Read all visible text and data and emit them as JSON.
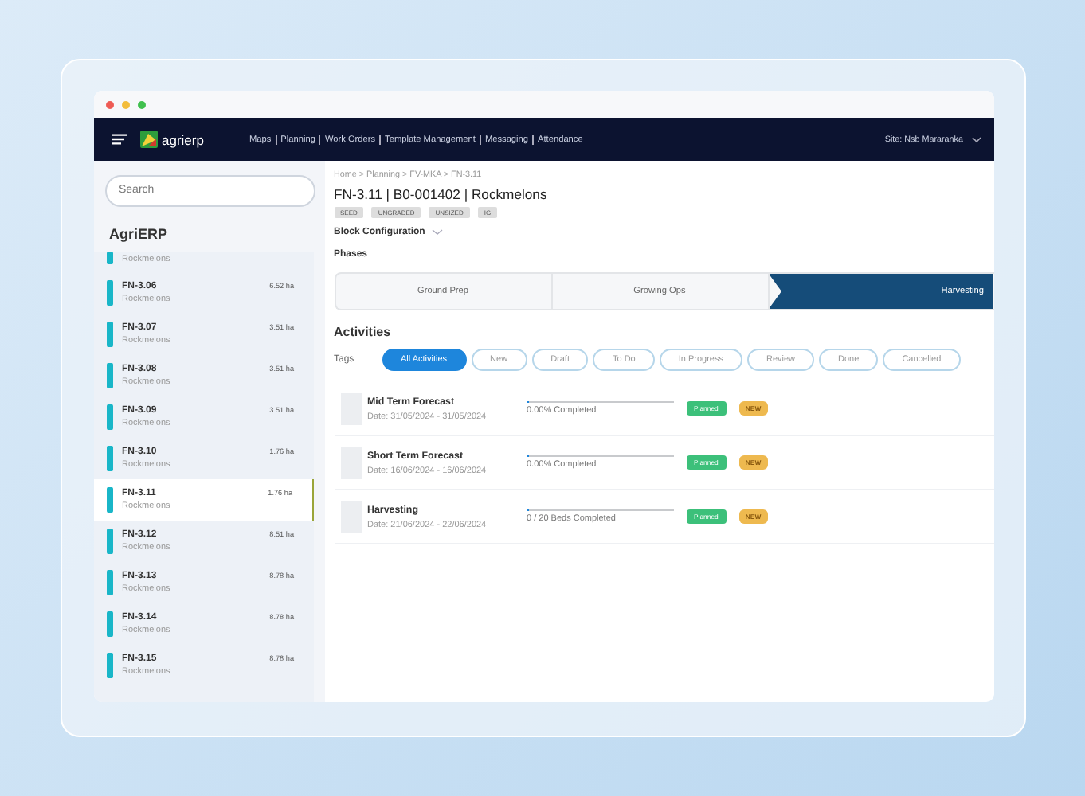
{
  "navbar": {
    "brand": "agrierp",
    "menu": [
      "Maps",
      "Planning",
      "Work Orders",
      "Template Management",
      "Messaging",
      "Attendance"
    ],
    "site": "Site: Nsb Mararanka"
  },
  "sidebar": {
    "search": {
      "placeholder": "Search"
    },
    "title": "AgriERP",
    "partial_item": {
      "crop": "Rockmelons"
    },
    "items": [
      {
        "name": "FN-3.06",
        "area": "6.52 ha",
        "crop": "Rockmelons",
        "selected": false
      },
      {
        "name": "FN-3.07",
        "area": "3.51 ha",
        "crop": "Rockmelons",
        "selected": false
      },
      {
        "name": "FN-3.08",
        "area": "3.51 ha",
        "crop": "Rockmelons",
        "selected": false
      },
      {
        "name": "FN-3.09",
        "area": "3.51 ha",
        "crop": "Rockmelons",
        "selected": false
      },
      {
        "name": "FN-3.10",
        "area": "1.76 ha",
        "crop": "Rockmelons",
        "selected": false
      },
      {
        "name": "FN-3.11",
        "area": "1.76 ha",
        "crop": "Rockmelons",
        "selected": true
      },
      {
        "name": "FN-3.12",
        "area": "8.51 ha",
        "crop": "Rockmelons",
        "selected": false
      },
      {
        "name": "FN-3.13",
        "area": "8.78 ha",
        "crop": "Rockmelons",
        "selected": false
      },
      {
        "name": "FN-3.14",
        "area": "8.78 ha",
        "crop": "Rockmelons",
        "selected": false
      },
      {
        "name": "FN-3.15",
        "area": "8.78 ha",
        "crop": "Rockmelons",
        "selected": false
      }
    ]
  },
  "main": {
    "breadcrumb": "Home > Planning > FV-MKA > FN-3.11",
    "title": "FN-3.11 | B0-001402 | Rockmelons",
    "tags": [
      "SEED",
      "UNGRADED",
      "UNSIZED",
      "IG"
    ],
    "block_configuration": "Block Configuration",
    "phases_label": "Phases",
    "phases": [
      {
        "label": "Ground Prep",
        "selected": false
      },
      {
        "label": "Growing Ops",
        "selected": false
      },
      {
        "label": "Harvesting",
        "selected": true
      }
    ],
    "activities_title": "Activities",
    "tags_label": "Tags",
    "filters": [
      {
        "label": "All Activities",
        "selected": true
      },
      {
        "label": "New",
        "selected": false
      },
      {
        "label": "Draft",
        "selected": false
      },
      {
        "label": "To Do",
        "selected": false
      },
      {
        "label": "In Progress",
        "selected": false
      },
      {
        "label": "Review",
        "selected": false
      },
      {
        "label": "Done",
        "selected": false
      },
      {
        "label": "Cancelled",
        "selected": false
      }
    ],
    "activities": [
      {
        "name": "Mid Term Forecast",
        "date": "Date: 31/05/2024 - 31/05/2024",
        "level": 0,
        "progress": "0.00% Completed",
        "status": "Planned",
        "badge": "NEW"
      },
      {
        "name": "Short Term Forecast",
        "date": "Date: 16/06/2024 - 16/06/2024",
        "level": 0,
        "progress": "0.00% Completed",
        "status": "Planned",
        "badge": "NEW"
      },
      {
        "name": "Harvesting",
        "date": "Date: 21/06/2024 - 22/06/2024",
        "level": 0,
        "progress": "0 / 20 Beds Completed",
        "status": "Planned",
        "badge": "NEW"
      }
    ]
  }
}
